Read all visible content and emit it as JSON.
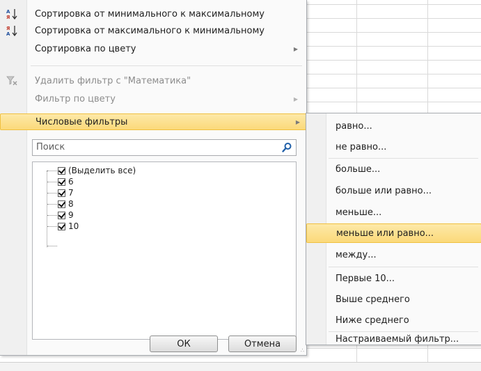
{
  "menu": {
    "items": [
      {
        "label": "Сортировка от минимального к максимальному",
        "icon": "sort-ascending-icon",
        "enabled": true
      },
      {
        "label": "Сортировка от максимального к минимальному",
        "icon": "sort-descending-icon",
        "enabled": true
      },
      {
        "label": "Сортировка по цвету",
        "icon": "",
        "enabled": true,
        "submenu": true
      },
      {
        "label": "Удалить фильтр с \"Математика\"",
        "icon": "clear-filter-icon",
        "enabled": false
      },
      {
        "label": "Фильтр по цвету",
        "icon": "",
        "enabled": false,
        "submenu": true
      },
      {
        "label": "Числовые фильтры",
        "icon": "",
        "enabled": true,
        "submenu": true,
        "active": true
      }
    ],
    "search_placeholder": "Поиск",
    "checklist": [
      "(Выделить все)",
      "6",
      "7",
      "8",
      "9",
      "10"
    ],
    "ok_label": "ОК",
    "cancel_label": "Отмена"
  },
  "submenu": {
    "items": [
      "равно...",
      "не равно...",
      "больше...",
      "больше или равно...",
      "меньше...",
      "меньше или равно...",
      "между...",
      "Первые 10...",
      "Выше среднего",
      "Ниже среднего",
      "Настраиваемый фильтр..."
    ],
    "active_index": 5
  },
  "colors": {
    "highlight": "#fbd97a",
    "highlight_border": "#f0c040"
  }
}
